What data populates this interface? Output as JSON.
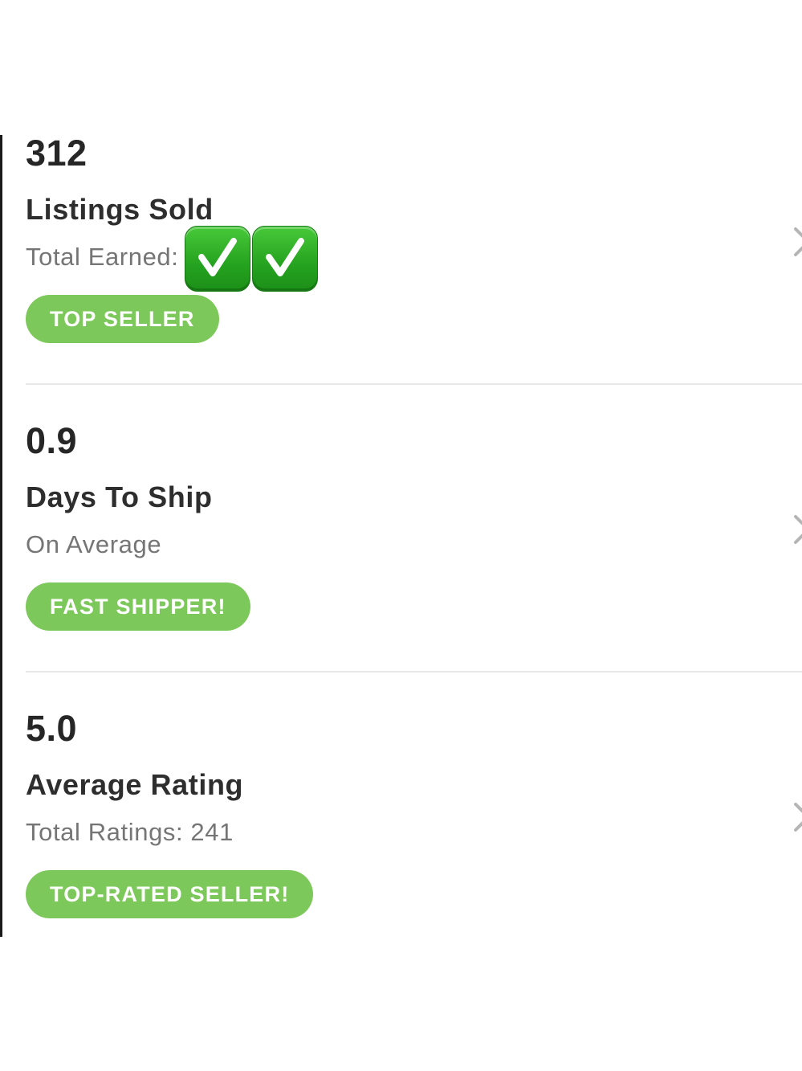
{
  "stats": [
    {
      "value": "312",
      "title": "Listings Sold",
      "subtitle": "Total Earned: ",
      "badge": "TOP SELLER"
    },
    {
      "value": "0.9",
      "title": "Days To Ship",
      "subtitle": "On Average",
      "badge": "FAST SHIPPER!"
    },
    {
      "value": "5.0",
      "title": "Average Rating",
      "subtitle": "Total Ratings: 241",
      "badge": "TOP-RATED SELLER!"
    }
  ],
  "icons": {
    "row_chevron": "chevron-right-icon",
    "overlay": [
      "check-mark-button-icon",
      "check-mark-button-icon"
    ]
  },
  "colors": {
    "badge": "#7dc85a",
    "value_text": "#262626",
    "subtitle_text": "#757575",
    "divider": "#e8e8e8",
    "check_icon": "#2fb52a"
  }
}
